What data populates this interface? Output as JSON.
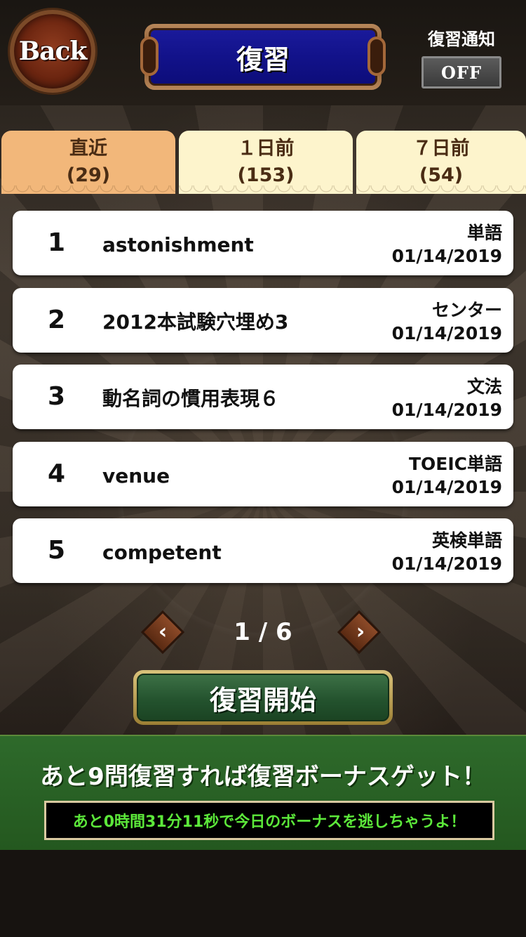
{
  "header": {
    "back_label": "Back",
    "title": "復習",
    "notify_label": "復習通知",
    "notify_value": "OFF"
  },
  "tabs": [
    {
      "label": "直近",
      "count": "(29)",
      "active": true
    },
    {
      "label": "１日前",
      "count": "(153)",
      "active": false
    },
    {
      "label": "７日前",
      "count": "(54)",
      "active": false
    }
  ],
  "items": [
    {
      "num": "1",
      "word": "astonishment",
      "category": "単語",
      "date": "01/14/2019"
    },
    {
      "num": "2",
      "word": "2012本試験穴埋め3",
      "category": "センター",
      "date": "01/14/2019"
    },
    {
      "num": "3",
      "word": "動名詞の慣用表現６",
      "category": "文法",
      "date": "01/14/2019"
    },
    {
      "num": "4",
      "word": "venue",
      "category": "TOEIC単語",
      "date": "01/14/2019"
    },
    {
      "num": "5",
      "word": "competent",
      "category": "英検単語",
      "date": "01/14/2019"
    }
  ],
  "pager": {
    "text": "1 / 6",
    "prev_glyph": "‹",
    "next_glyph": "›"
  },
  "start_button": "復習開始",
  "bonus": {
    "message": "あと9問復習すれば復習ボーナスゲット！",
    "timer": "あと0時間31分11秒で今日のボーナスを逃しちゃうよ！"
  },
  "colors": {
    "tab_active": "#f2b77a",
    "tab_inactive": "#fdf4cc",
    "title_blue": "#12128a",
    "start_green": "#24532e",
    "bonus_green": "#2e6a2b",
    "timer_text": "#5ce83a"
  }
}
